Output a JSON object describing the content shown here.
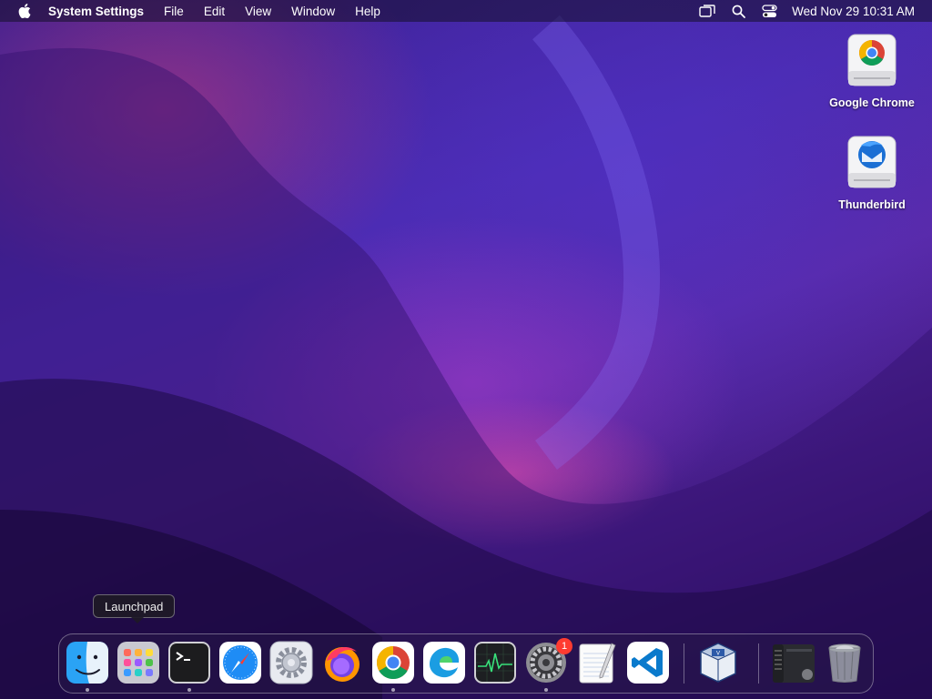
{
  "menubar": {
    "app_name": "System Settings",
    "menus": [
      "File",
      "Edit",
      "View",
      "Window",
      "Help"
    ],
    "clock": "Wed Nov 29  10:31 AM",
    "status_icons": [
      "screen-mirroring-icon",
      "spotlight-search-icon",
      "control-center-icon"
    ]
  },
  "desktop": {
    "icons": [
      {
        "label": "Google Chrome",
        "icon": "chrome-disk-icon"
      },
      {
        "label": "Thunderbird",
        "icon": "thunderbird-disk-icon"
      }
    ]
  },
  "tooltip": {
    "text": "Launchpad"
  },
  "dock": {
    "items": [
      {
        "name": "Finder",
        "icon": "finder-icon",
        "running": true
      },
      {
        "name": "Launchpad",
        "icon": "launchpad-icon",
        "running": false
      },
      {
        "name": "Terminal",
        "icon": "terminal-icon",
        "running": true
      },
      {
        "name": "Safari",
        "icon": "safari-icon",
        "running": false
      },
      {
        "name": "Settings Utility",
        "icon": "settings-gear-icon",
        "running": false
      },
      {
        "name": "Firefox",
        "icon": "firefox-icon",
        "running": false
      },
      {
        "name": "Google Chrome",
        "icon": "chrome-icon",
        "running": true
      },
      {
        "name": "Microsoft Edge",
        "icon": "edge-icon",
        "running": false
      },
      {
        "name": "Activity Monitor",
        "icon": "activity-monitor-icon",
        "running": false
      },
      {
        "name": "System Settings",
        "icon": "system-settings-icon",
        "running": true,
        "badge": "1"
      },
      {
        "name": "TextEdit",
        "icon": "textedit-icon",
        "running": false
      },
      {
        "name": "Visual Studio Code",
        "icon": "vscode-icon",
        "running": false
      },
      {
        "name": "VirtualBox",
        "icon": "virtualbox-icon",
        "running": false
      },
      {
        "name": "Recent Window",
        "icon": "window-thumbnail-icon",
        "running": false
      },
      {
        "name": "Trash",
        "icon": "trash-icon",
        "running": false
      }
    ]
  },
  "colors": {
    "accent_badge": "#ff3b30",
    "menubar_text": "#ffffff"
  }
}
